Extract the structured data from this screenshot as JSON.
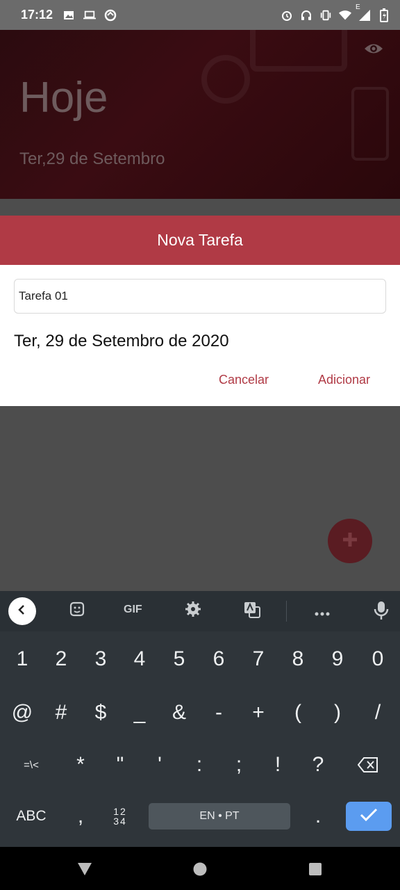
{
  "status_bar": {
    "time": "17:12",
    "left_icons": [
      "image-icon",
      "laptop-icon",
      "sync-icon"
    ],
    "right_icons": [
      "alarm-icon",
      "headphones-icon",
      "vibrate-icon",
      "wifi-icon",
      "signal-icon",
      "battery-charging-icon"
    ],
    "network_label": "E"
  },
  "hero": {
    "title": "Hoje",
    "date": "Ter,29 de Setembro",
    "eye_icon": "eye-icon"
  },
  "dialog": {
    "title": "Nova Tarefa",
    "task_value": "Tarefa 01",
    "date_text": "Ter, 29 de Setembro de 2020",
    "cancel_label": "Cancelar",
    "add_label": "Adicionar"
  },
  "fab": {
    "icon": "plus-icon"
  },
  "keyboard": {
    "toolbar": {
      "gif_label": "GIF",
      "icons": [
        "back-arrow-icon",
        "sticker-icon",
        "gear-icon",
        "translate-icon",
        "more-icon",
        "mic-icon"
      ]
    },
    "row1": [
      "1",
      "2",
      "3",
      "4",
      "5",
      "6",
      "7",
      "8",
      "9",
      "0"
    ],
    "row2": [
      "@",
      "#",
      "$",
      "_",
      "&",
      "-",
      "+",
      "(",
      ")",
      "/"
    ],
    "row3": [
      "=\\<",
      "*",
      "\"",
      "'",
      ":",
      ";",
      "!",
      "?"
    ],
    "abc_label": "ABC",
    "comma_label": ",",
    "numpad_top": "12",
    "numpad_bottom": "34",
    "space_label": "EN • PT",
    "period_label": ".",
    "enter_icon": "check-icon",
    "backspace_icon": "backspace-icon"
  },
  "nav_bar": {
    "icons": [
      "back-triangle-icon",
      "home-circle-icon",
      "recents-square-icon"
    ]
  }
}
